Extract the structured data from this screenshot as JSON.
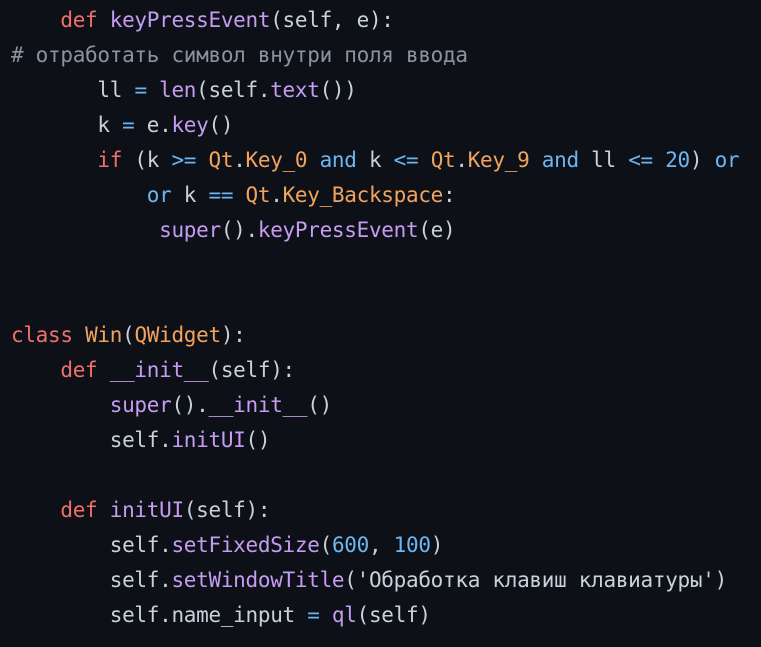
{
  "code_lines": [
    [
      [
        "t",
        "    "
      ],
      [
        "k",
        "def"
      ],
      [
        "t",
        " "
      ],
      [
        "f",
        "keyPressEvent"
      ],
      [
        "t",
        "(self, e):"
      ]
    ],
    [
      [
        "c",
        "# отработать символ внутри поля ввода"
      ]
    ],
    [
      [
        "t",
        "       ll "
      ],
      [
        "n",
        "="
      ],
      [
        "t",
        " "
      ],
      [
        "f",
        "len"
      ],
      [
        "t",
        "(self."
      ],
      [
        "f",
        "text"
      ],
      [
        "t",
        "())"
      ]
    ],
    [
      [
        "t",
        "       k "
      ],
      [
        "n",
        "="
      ],
      [
        "t",
        " e."
      ],
      [
        "f",
        "key"
      ],
      [
        "t",
        "()"
      ]
    ],
    [
      [
        "t",
        "       "
      ],
      [
        "k",
        "if"
      ],
      [
        "t",
        " (k "
      ],
      [
        "n",
        ">="
      ],
      [
        "t",
        " "
      ],
      [
        "o",
        "Qt"
      ],
      [
        "t",
        "."
      ],
      [
        "o",
        "Key_0"
      ],
      [
        "t",
        " "
      ],
      [
        "n",
        "and"
      ],
      [
        "t",
        " k "
      ],
      [
        "n",
        "<="
      ],
      [
        "t",
        " "
      ],
      [
        "o",
        "Qt"
      ],
      [
        "t",
        "."
      ],
      [
        "o",
        "Key_9"
      ],
      [
        "t",
        " "
      ],
      [
        "n",
        "and"
      ],
      [
        "t",
        " ll "
      ],
      [
        "n",
        "<="
      ],
      [
        "t",
        " "
      ],
      [
        "n",
        "20"
      ],
      [
        "t",
        ") "
      ],
      [
        "n",
        "or"
      ]
    ],
    [
      [
        "t",
        "           "
      ],
      [
        "n",
        "or"
      ],
      [
        "t",
        " k "
      ],
      [
        "n",
        "=="
      ],
      [
        "t",
        " "
      ],
      [
        "o",
        "Qt"
      ],
      [
        "t",
        "."
      ],
      [
        "o",
        "Key_Backspace"
      ],
      [
        "t",
        ":"
      ]
    ],
    [
      [
        "t",
        "            "
      ],
      [
        "f",
        "super"
      ],
      [
        "t",
        "()."
      ],
      [
        "f",
        "keyPressEvent"
      ],
      [
        "t",
        "(e)"
      ]
    ],
    [],
    [],
    [
      [
        "k",
        "class"
      ],
      [
        "t",
        " "
      ],
      [
        "o",
        "Win"
      ],
      [
        "t",
        "("
      ],
      [
        "o",
        "QWidget"
      ],
      [
        "t",
        "):"
      ]
    ],
    [
      [
        "t",
        "    "
      ],
      [
        "k",
        "def"
      ],
      [
        "t",
        " "
      ],
      [
        "f",
        "__init__"
      ],
      [
        "t",
        "(self):"
      ]
    ],
    [
      [
        "t",
        "        "
      ],
      [
        "f",
        "super"
      ],
      [
        "t",
        "()."
      ],
      [
        "f",
        "__init__"
      ],
      [
        "t",
        "()"
      ]
    ],
    [
      [
        "t",
        "        self."
      ],
      [
        "f",
        "initUI"
      ],
      [
        "t",
        "()"
      ]
    ],
    [],
    [
      [
        "t",
        "    "
      ],
      [
        "k",
        "def"
      ],
      [
        "t",
        " "
      ],
      [
        "f",
        "initUI"
      ],
      [
        "t",
        "(self):"
      ]
    ],
    [
      [
        "t",
        "        self."
      ],
      [
        "f",
        "setFixedSize"
      ],
      [
        "t",
        "("
      ],
      [
        "n",
        "600"
      ],
      [
        "t",
        ", "
      ],
      [
        "n",
        "100"
      ],
      [
        "t",
        ")"
      ]
    ],
    [
      [
        "t",
        "        self."
      ],
      [
        "f",
        "setWindowTitle"
      ],
      [
        "t",
        "("
      ],
      [
        "s",
        "'Обработка клавиш клавиатуры'"
      ],
      [
        "t",
        ")"
      ]
    ],
    [
      [
        "t",
        "        self.name_input "
      ],
      [
        "n",
        "="
      ],
      [
        "t",
        " "
      ],
      [
        "f",
        "ql"
      ],
      [
        "t",
        "(self)"
      ]
    ]
  ]
}
